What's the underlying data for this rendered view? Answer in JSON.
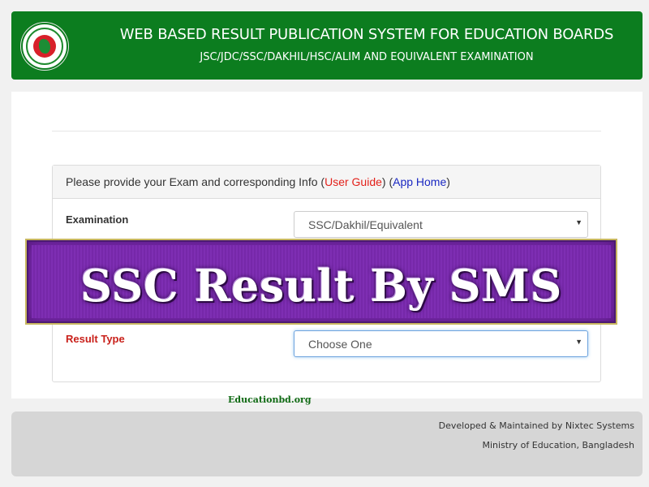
{
  "header": {
    "title": "WEB BASED RESULT PUBLICATION SYSTEM FOR EDUCATION BOARDS",
    "subtitle": "JSC/JDC/SSC/DAKHIL/HSC/ALIM AND EQUIVALENT EXAMINATION",
    "logo_icon": "bangladesh-government-seal-icon"
  },
  "panel": {
    "intro_text": "Please provide your Exam and corresponding Info (",
    "user_guide_link": "User Guide",
    "sep_text": ") (",
    "app_home_link": "App Home",
    "end_text": ")",
    "fields": {
      "examination": {
        "label": "Examination",
        "value": "SSC/Dakhil/Equivalent"
      },
      "result_type": {
        "label": "Result Type",
        "value": "Choose One"
      }
    },
    "caret_glyph": "▼"
  },
  "banner": {
    "text": "SSC Result By SMS"
  },
  "watermark": {
    "text": "Educationbd.org"
  },
  "footer": {
    "developer": "Developed & Maintained by Nixtec Systems",
    "ministry": "Ministry of Education, Bangladesh"
  },
  "colors": {
    "header_green": "#0c7d1f",
    "link_red": "#e3211b",
    "link_blue": "#1a28c2",
    "banner_purple": "#7b2bb0"
  }
}
